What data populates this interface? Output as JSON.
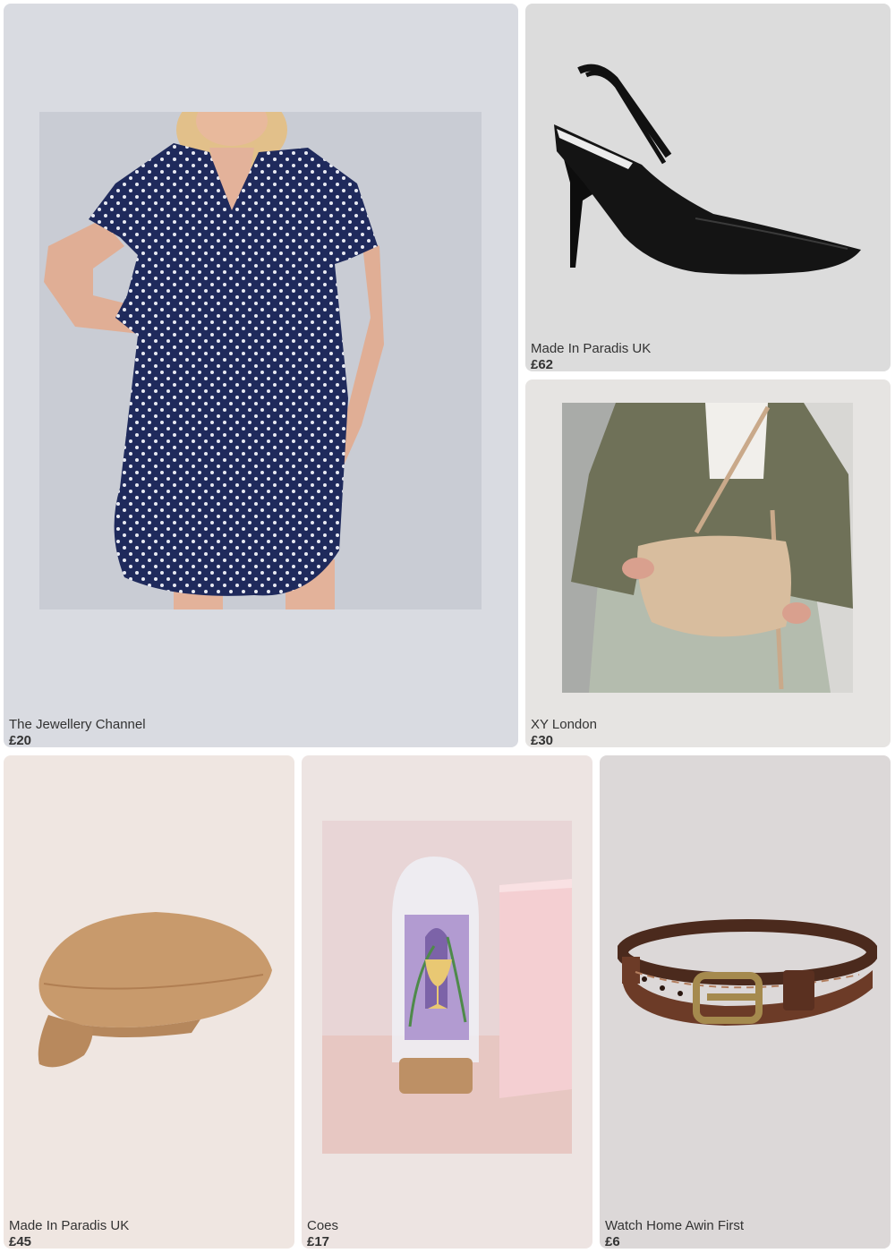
{
  "products": [
    {
      "brand": "The Jewellery Channel",
      "price": "£20",
      "image": "navy-polka-dot-dress"
    },
    {
      "brand": "Made In Paradis UK",
      "price": "£62",
      "image": "black-slingback-heel"
    },
    {
      "brand": "XY London",
      "price": "£30",
      "image": "beige-shoulder-bag"
    },
    {
      "brand": "Made In Paradis UK",
      "price": "£45",
      "image": "camel-baker-boy-cap"
    },
    {
      "brand": "Coes",
      "price": "£17",
      "image": "cocktail-pin-in-glass-dome"
    },
    {
      "brand": "Watch Home Awin First",
      "price": "£6",
      "image": "brown-leather-bracelet"
    }
  ]
}
